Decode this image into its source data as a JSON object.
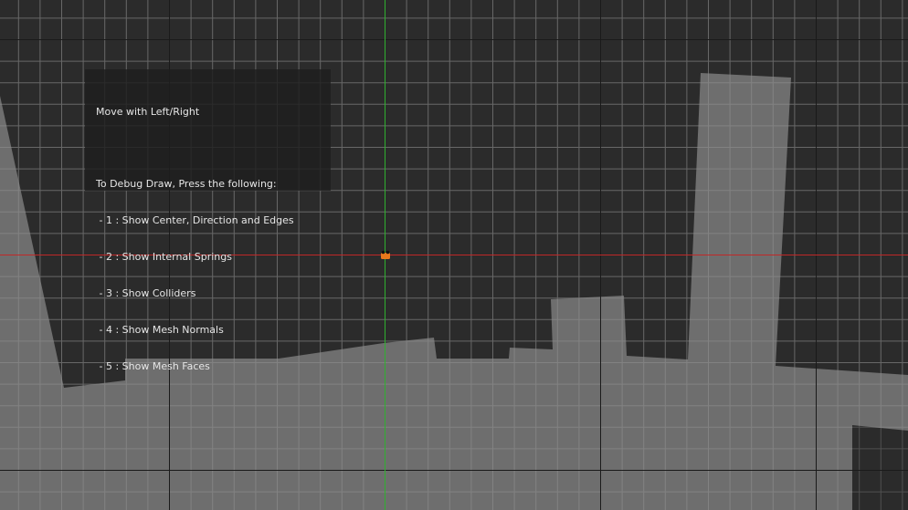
{
  "colors": {
    "background": "#2b2b2b",
    "terrain": "#6e6e6e",
    "grid_minor": "#4a4a4a",
    "grid_major": "#1a1a1a",
    "axis_x": "#c02828",
    "axis_y": "#2fb02f",
    "player_body": "#e8781c",
    "panel_bg": "#1e1e1e",
    "panel_text": "#e6e6e6"
  },
  "help": {
    "title": "Move with Left/Right",
    "debug_header": "To Debug Draw, Press the following:",
    "items": [
      " - 1 : Show Center, Direction and Edges",
      " - 2 : Show Internal Springs",
      " - 3 : Show Colliders",
      " - 4 : Show Mesh Normals",
      " - 5 : Show Mesh Faces"
    ]
  },
  "player": {
    "icon": "softbody-blob-icon"
  }
}
